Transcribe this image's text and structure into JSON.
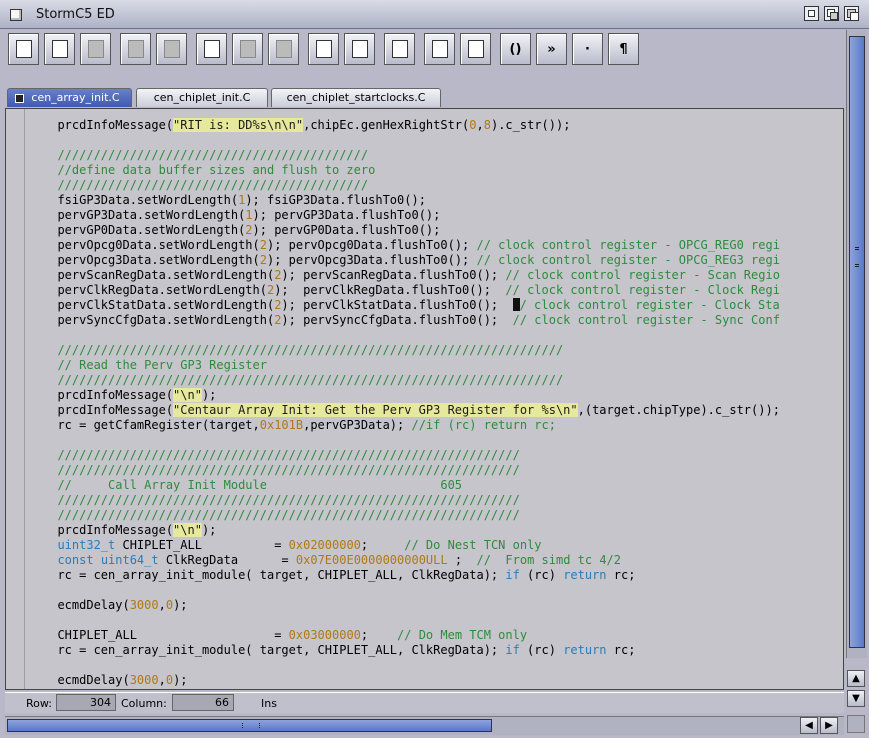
{
  "window": {
    "title": "StormC5 ED"
  },
  "toolbar": {
    "buttons": [
      {
        "icon": "new-document-icon",
        "enabled": true
      },
      {
        "icon": "save-disk-icon",
        "enabled": true
      },
      {
        "icon": "blank-icon",
        "enabled": false
      },
      {
        "icon": "cut-scissors-icon",
        "enabled": false
      },
      {
        "icon": "copy-icon",
        "enabled": false
      },
      {
        "icon": "paste-clipboard-icon",
        "enabled": true
      },
      {
        "icon": "undo-icon",
        "enabled": false
      },
      {
        "icon": "redo-icon",
        "enabled": false
      },
      {
        "icon": "indent-icon",
        "enabled": true
      },
      {
        "icon": "outdent-icon",
        "enabled": true
      },
      {
        "icon": "lock-icon",
        "enabled": true
      },
      {
        "icon": "list-marker-icon",
        "enabled": true
      },
      {
        "icon": "list-columns-icon",
        "enabled": true
      },
      {
        "icon": "brackets-icon",
        "enabled": true,
        "label": "()"
      },
      {
        "icon": "guillemet-icon",
        "enabled": true,
        "label": "»"
      },
      {
        "icon": "middle-dot-icon",
        "enabled": true,
        "label": "·"
      },
      {
        "icon": "pilcrow-icon",
        "enabled": true,
        "label": "¶"
      }
    ]
  },
  "tabs": [
    {
      "label": "cen_array_init.C",
      "active": true
    },
    {
      "label": "cen_chiplet_init.C",
      "active": false
    },
    {
      "label": "cen_chiplet_startclocks.C",
      "active": false
    }
  ],
  "editor": {
    "lines": [
      [
        [
          "t",
          "  prcdInfoMessage("
        ],
        [
          "s",
          "\"RIT is: DD%s\\n\\n\""
        ],
        [
          "t",
          ",chipEc.genHexRightStr("
        ],
        [
          "n",
          "0"
        ],
        [
          "t",
          ","
        ],
        [
          "n",
          "8"
        ],
        [
          "t",
          ").c_str());"
        ]
      ],
      [],
      [
        [
          "c",
          "  ///////////////////////////////////////////"
        ]
      ],
      [
        [
          "c",
          "  //define data buffer sizes and flush to zero"
        ]
      ],
      [
        [
          "c",
          "  ///////////////////////////////////////////"
        ]
      ],
      [
        [
          "t",
          "  fsiGP3Data.setWordLength("
        ],
        [
          "n",
          "1"
        ],
        [
          "t",
          "); fsiGP3Data.flushTo0();"
        ]
      ],
      [
        [
          "t",
          "  pervGP3Data.setWordLength("
        ],
        [
          "n",
          "1"
        ],
        [
          "t",
          "); pervGP3Data.flushTo0();"
        ]
      ],
      [
        [
          "t",
          "  pervGP0Data.setWordLength("
        ],
        [
          "n",
          "2"
        ],
        [
          "t",
          "); pervGP0Data.flushTo0();"
        ]
      ],
      [
        [
          "t",
          "  pervOpcg0Data.setWordLength("
        ],
        [
          "n",
          "2"
        ],
        [
          "t",
          "); pervOpcg0Data.flushTo0(); "
        ],
        [
          "c",
          "// clock control register - OPCG_REG0 regi"
        ]
      ],
      [
        [
          "t",
          "  pervOpcg3Data.setWordLength("
        ],
        [
          "n",
          "2"
        ],
        [
          "t",
          "); pervOpcg3Data.flushTo0(); "
        ],
        [
          "c",
          "// clock control register - OPCG_REG3 regi"
        ]
      ],
      [
        [
          "t",
          "  pervScanRegData.setWordLength("
        ],
        [
          "n",
          "2"
        ],
        [
          "t",
          "); pervScanRegData.flushTo0(); "
        ],
        [
          "c",
          "// clock control register - Scan Regio"
        ]
      ],
      [
        [
          "t",
          "  pervClkRegData.setWordLength("
        ],
        [
          "n",
          "2"
        ],
        [
          "t",
          ");  pervClkRegData.flushTo0();  "
        ],
        [
          "c",
          "// clock control register - Clock Regi"
        ]
      ],
      [
        [
          "t",
          "  pervClkStatData.setWordLength("
        ],
        [
          "n",
          "2"
        ],
        [
          "t",
          "); pervClkStatData.flushTo0();  "
        ],
        [
          "x",
          ""
        ],
        [
          "c",
          "/ clock control register - Clock Sta"
        ]
      ],
      [
        [
          "t",
          "  pervSyncCfgData.setWordLength("
        ],
        [
          "n",
          "2"
        ],
        [
          "t",
          "); pervSyncCfgData.flushTo0();  "
        ],
        [
          "c",
          "// clock control register - Sync Conf"
        ]
      ],
      [],
      [
        [
          "c",
          "  //////////////////////////////////////////////////////////////////////"
        ]
      ],
      [
        [
          "c",
          "  // Read the Perv GP3 Register"
        ]
      ],
      [
        [
          "c",
          "  //////////////////////////////////////////////////////////////////////"
        ]
      ],
      [
        [
          "t",
          "  prcdInfoMessage("
        ],
        [
          "s",
          "\"\\n\""
        ],
        [
          "t",
          ");"
        ]
      ],
      [
        [
          "t",
          "  prcdInfoMessage("
        ],
        [
          "s",
          "\"Centaur Array Init: Get the Perv GP3 Register for %s\\n\""
        ],
        [
          "t",
          ",(target.chipType).c_str());"
        ]
      ],
      [
        [
          "t",
          "  rc = getCfamRegister(target,"
        ],
        [
          "n",
          "0x101B"
        ],
        [
          "t",
          ",pervGP3Data); "
        ],
        [
          "c",
          "//if (rc) return rc;"
        ]
      ],
      [],
      [
        [
          "c",
          "  ////////////////////////////////////////////////////////////////"
        ]
      ],
      [
        [
          "c",
          "  ////////////////////////////////////////////////////////////////"
        ]
      ],
      [
        [
          "c",
          "  //     Call Array Init Module                        605"
        ]
      ],
      [
        [
          "c",
          "  ////////////////////////////////////////////////////////////////"
        ]
      ],
      [
        [
          "c",
          "  ////////////////////////////////////////////////////////////////"
        ]
      ],
      [
        [
          "t",
          "  prcdInfoMessage("
        ],
        [
          "s",
          "\"\\n\""
        ],
        [
          "t",
          ");"
        ]
      ],
      [
        [
          "t",
          "  "
        ],
        [
          "k",
          "uint32_t"
        ],
        [
          "t",
          " CHIPLET_ALL          = "
        ],
        [
          "n",
          "0x02000000"
        ],
        [
          "t",
          ";     "
        ],
        [
          "c",
          "// Do Nest TCN only"
        ]
      ],
      [
        [
          "t",
          "  "
        ],
        [
          "k",
          "const"
        ],
        [
          "t",
          " "
        ],
        [
          "k",
          "uint64_t"
        ],
        [
          "t",
          " ClkRegData      = "
        ],
        [
          "n",
          "0x07E00E0000000000ULL"
        ],
        [
          "t",
          " ;  "
        ],
        [
          "c",
          "//  From simd tc 4/2"
        ]
      ],
      [
        [
          "t",
          "  rc = cen_array_init_module( target, CHIPLET_ALL, ClkRegData); "
        ],
        [
          "k",
          "if"
        ],
        [
          "t",
          " (rc) "
        ],
        [
          "k",
          "return"
        ],
        [
          "t",
          " rc;"
        ]
      ],
      [],
      [
        [
          "t",
          "  ecmdDelay("
        ],
        [
          "n",
          "3000"
        ],
        [
          "t",
          ","
        ],
        [
          "n",
          "0"
        ],
        [
          "t",
          ");"
        ]
      ],
      [],
      [
        [
          "t",
          "  CHIPLET_ALL                   = "
        ],
        [
          "n",
          "0x03000000"
        ],
        [
          "t",
          ";    "
        ],
        [
          "c",
          "// Do Mem TCM only"
        ]
      ],
      [
        [
          "t",
          "  rc = cen_array_init_module( target, CHIPLET_ALL, ClkRegData); "
        ],
        [
          "k",
          "if"
        ],
        [
          "t",
          " (rc) "
        ],
        [
          "k",
          "return"
        ],
        [
          "t",
          " rc;"
        ]
      ],
      [],
      [
        [
          "t",
          "  ecmdDelay("
        ],
        [
          "n",
          "3000"
        ],
        [
          "t",
          ","
        ],
        [
          "n",
          "0"
        ],
        [
          "t",
          ");"
        ]
      ]
    ]
  },
  "statusbar": {
    "row_label": "Row:",
    "row_value": "304",
    "column_label": "Column:",
    "column_value": "66",
    "mode": "Ins"
  }
}
